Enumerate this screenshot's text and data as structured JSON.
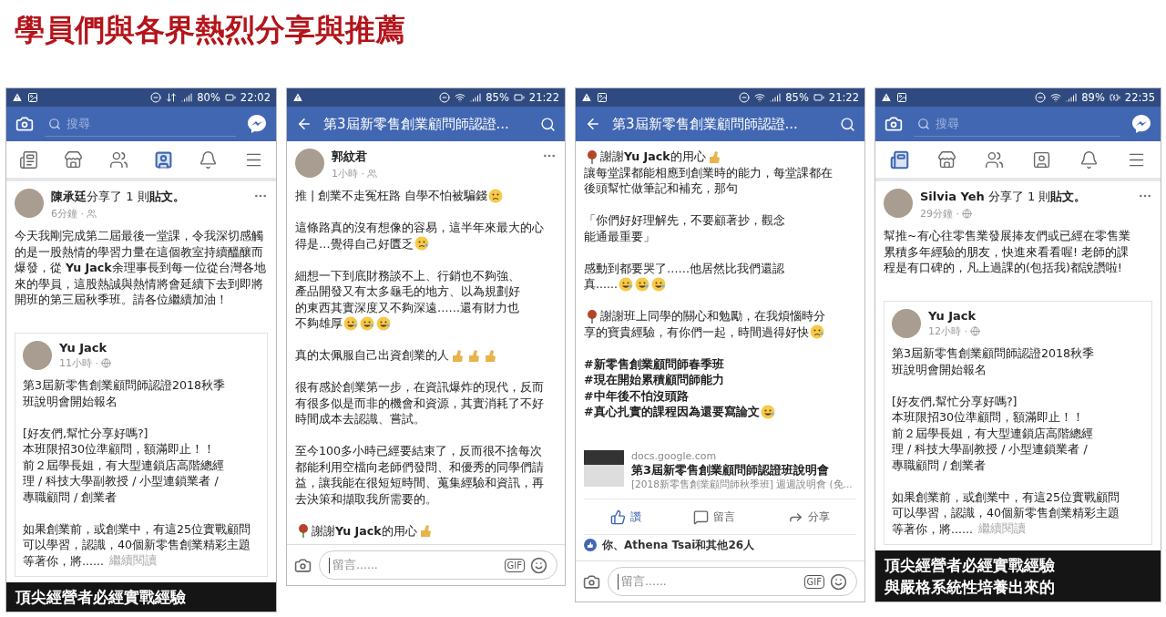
{
  "title": "學員們與各界熱烈分享與推薦",
  "phones": [
    {
      "status": {
        "photo_notice": true,
        "wifi": false,
        "battery": "80%",
        "charging": false,
        "time": "22:02"
      },
      "header": {
        "kind": "search",
        "placeholder": "搜尋"
      },
      "nav": [
        {
          "kind": "feed",
          "selected": false
        },
        {
          "kind": "market",
          "selected": false
        },
        {
          "kind": "groups",
          "selected": false
        },
        {
          "kind": "profile",
          "selected": true
        },
        {
          "kind": "alerts",
          "selected": false
        },
        {
          "kind": "menu",
          "selected": false
        }
      ],
      "post": {
        "author": "**陳承廷**分享了 1 則**貼文。**",
        "time": "6分鐘 ·",
        "public": false,
        "paragraphs": [
          {
            "lines": [
              {
                "text": "今天我剛完成第二屆最後一堂課，令我深切感觸"
              },
              {
                "text": "的是一股熱情的學習力量在這個教室持續醞釀而"
              },
              {
                "text": "爆發，從 **Yu Jack**余理事長到每一位從台灣各地"
              },
              {
                "text": "來的學員，這股熱誠與熱情將會延續下去到即將"
              },
              {
                "text": "開班的第三屆秋季班。請各位繼續加油！"
              }
            ]
          }
        ],
        "shared": {
          "author": "Yu Jack",
          "time": "11小時 ·",
          "public": true,
          "paragraphs": [
            {
              "lines": [
                {
                  "text": "第3屆新零售創業顧問師認證2018秋季"
                },
                {
                  "text": "班說明會開始報名"
                }
              ]
            },
            {
              "lines": [
                {
                  "text": "[好友們,幫忙分享好嗎?]"
                },
                {
                  "text": "本班限招30位準顧問，額滿即止！！"
                },
                {
                  "text": "前２屆學長姐，有大型連鎖店高階總經"
                },
                {
                  "text": "理 / 科技大學副教授 / 小型連鎖業者 /"
                },
                {
                  "text": "專職顧問 / 創業者"
                }
              ]
            },
            {
              "lines": [
                {
                  "text": "如果創業前，或創業中，有這25位實戰顧問"
                },
                {
                  "text": "可以學習，認識，40個新零售創業精彩主題"
                },
                {
                  "text": "等著你，將......",
                  "more": "繼續閱讀"
                }
              ]
            }
          ]
        },
        "banner": [
          "頂尖經營者必經實戰經驗"
        ]
      }
    },
    {
      "status": {
        "photo_notice": false,
        "wifi": true,
        "battery": "85%",
        "charging": false,
        "time": "21:22"
      },
      "header": {
        "kind": "title",
        "title": "第3屆新零售創業顧問師認證..."
      },
      "post": {
        "author": "**郭紋君**",
        "time": "1小時 ·",
        "public": false,
        "paragraphs": [
          {
            "lines": [
              {
                "text": "推 | 創業不走冤枉路 自學不怕被騙錢",
                "trail": [
                  {
                    "kind": "thinking"
                  }
                ]
              }
            ]
          },
          {
            "lines": [
              {
                "text": "這條路真的沒有想像的容易，這半年來最大的心"
              },
              {
                "text": "得是…覺得自己好匱乏",
                "trail": [
                  {
                    "kind": "anxious"
                  }
                ]
              }
            ]
          },
          {
            "lines": [
              {
                "text": "細想一下到底財務談不上、行銷也不夠強、"
              },
              {
                "text": "產品開發又有太多龜毛的地方、以為規劃好"
              },
              {
                "text": "的東西其實深度又不夠深遠……還有財力也"
              },
              {
                "text": "不夠雄厚",
                "trail": [
                  {
                    "kind": "laugh"
                  },
                  {
                    "kind": "laugh"
                  },
                  {
                    "kind": "laugh"
                  }
                ]
              }
            ]
          },
          {
            "lines": [
              {
                "text": "真的太佩服自己出資創業的人",
                "trail": [
                  {
                    "kind": "muscle"
                  },
                  {
                    "kind": "muscle"
                  },
                  {
                    "kind": "muscle"
                  }
                ]
              }
            ]
          },
          {
            "lines": [
              {
                "text": "很有感於創業第一步，在資訊爆炸的現代，反而"
              },
              {
                "text": "有很多似是而非的機會和資源，其實消耗了不好"
              },
              {
                "text": "時間成本去認識、嘗試。"
              }
            ]
          },
          {
            "lines": [
              {
                "text": "至今100多小時已經要結束了，反而很不捨每次"
              },
              {
                "text": "都能利用空檔向老師們發問、和優秀的同學們請"
              },
              {
                "text": "益，讓我能在很短短時間、蒐集經驗和資訊，再"
              },
              {
                "text": "去決策和擷取我所需要的。"
              }
            ]
          },
          {
            "lines": [
              {
                "text": "謝謝**Yu Jack**的用心",
                "lead": {
                  "kind": "rose"
                },
                "trail": [
                  {
                    "kind": "thumbs"
                  }
                ]
              }
            ]
          }
        ]
      },
      "comment_bar": {
        "placeholder": "留言......",
        "gif": "GIF"
      }
    },
    {
      "status": {
        "photo_notice": true,
        "wifi": true,
        "battery": "85%",
        "charging": false,
        "time": "21:22"
      },
      "header": {
        "kind": "title",
        "title": "第3屆新零售創業顧問師認證..."
      },
      "post": {
        "paragraphs": [
          {
            "lines": [
              {
                "text": "謝謝**Yu Jack**的用心",
                "lead": {
                  "kind": "rose"
                },
                "trail": [
                  {
                    "kind": "thumbs"
                  }
                ]
              },
              {
                "text": "讓每堂課都能相應到創業時的能力，每堂課都在"
              },
              {
                "text": "後頭幫忙做筆記和補充，那句"
              }
            ]
          },
          {
            "lines": [
              {
                "text": "「你們好好理解先，不要顧著抄，觀念"
              },
              {
                "text": "能通最重要」"
              }
            ]
          },
          {
            "lines": [
              {
                "text": "感動到都要哭了……他居然比我們還認"
              },
              {
                "text": "真......",
                "trail": [
                  {
                    "kind": "laugh"
                  },
                  {
                    "kind": "laugh"
                  },
                  {
                    "kind": "laugh"
                  }
                ]
              }
            ]
          },
          {
            "lines": [
              {
                "text": "謝謝班上同學的關心和勉勵，在我煩惱時分",
                "lead": {
                  "kind": "rose"
                }
              },
              {
                "text": "享的寶貴經驗，有你們一起，時間過得好快",
                "trail": [
                  {
                    "kind": "crying"
                  }
                ]
              }
            ]
          },
          {
            "lines": [
              {
                "text": "#新零售創業顧問師春季班",
                "bold": true
              },
              {
                "text": "#現在開始累積顧問師能力",
                "bold": true
              },
              {
                "text": "#中年後不怕沒頭路",
                "bold": true
              },
              {
                "text": "#真心扎實的課程因為還要寫論文",
                "bold": true,
                "trail": [
                  {
                    "kind": "laugh"
                  }
                ]
              }
            ]
          }
        ],
        "link": {
          "domain": "docs.google.com",
          "title": "第3屆新零售創業顧問師認證班說明會",
          "description": "[2018新零售創業顧問師秋季班] 週週說明會 (免..."
        },
        "actions": [
          {
            "kind": "like",
            "label": "讚",
            "selected": true
          },
          {
            "kind": "comment",
            "label": "留言",
            "selected": false
          },
          {
            "kind": "share",
            "label": "分享",
            "selected": false
          }
        ],
        "reactions": "你、Athena Tsai和其他26人"
      },
      "comment_bar": {
        "placeholder": "留言......",
        "gif": "GIF"
      }
    },
    {
      "status": {
        "photo_notice": true,
        "wifi": true,
        "battery": "89%",
        "charging": true,
        "time": "22:35"
      },
      "header": {
        "kind": "search",
        "placeholder": "搜尋"
      },
      "nav": [
        {
          "kind": "feed",
          "selected": true
        },
        {
          "kind": "market",
          "selected": false
        },
        {
          "kind": "groups",
          "selected": false
        },
        {
          "kind": "profile",
          "selected": false
        },
        {
          "kind": "alerts",
          "selected": false
        },
        {
          "kind": "menu",
          "selected": false
        }
      ],
      "post": {
        "author": "**Silvia Yeh** 分享了 1 則**貼文。**",
        "time": "29分鐘 ·",
        "public": true,
        "paragraphs": [
          {
            "lines": [
              {
                "text": "幫推~有心往零售業發展捧友們或已經在零售業"
              },
              {
                "text": "累積多年經驗的朋友，快進來看看喔! 老師的課"
              },
              {
                "text": "程是有口碑的，凡上過課的(包括我)都說讚啦!"
              }
            ]
          }
        ],
        "shared": {
          "author": "Yu Jack",
          "time": "12小時 ·",
          "public": true,
          "paragraphs": [
            {
              "lines": [
                {
                  "text": "第3屆新零售創業顧問師認證2018秋季"
                },
                {
                  "text": "班說明會開始報名"
                }
              ]
            },
            {
              "lines": [
                {
                  "text": "[好友們,幫忙分享好嗎?]"
                },
                {
                  "text": "本班限招30位準顧問，額滿即止！！"
                },
                {
                  "text": "前２屆學長姐，有大型連鎖店高階總經"
                },
                {
                  "text": "理 / 科技大學副教授 / 小型連鎖業者 /"
                },
                {
                  "text": "專職顧問 / 創業者"
                }
              ]
            },
            {
              "lines": [
                {
                  "text": "如果創業前，或創業中，有這25位實戰顧問"
                },
                {
                  "text": "可以學習，認識，40個新零售創業精彩主題"
                },
                {
                  "text": "等著你，將......",
                  "more": "繼續閱讀"
                }
              ]
            }
          ]
        },
        "banner": [
          "頂尖經營者必經實戰經驗",
          "與嚴格系統性培養出來的"
        ]
      }
    }
  ]
}
